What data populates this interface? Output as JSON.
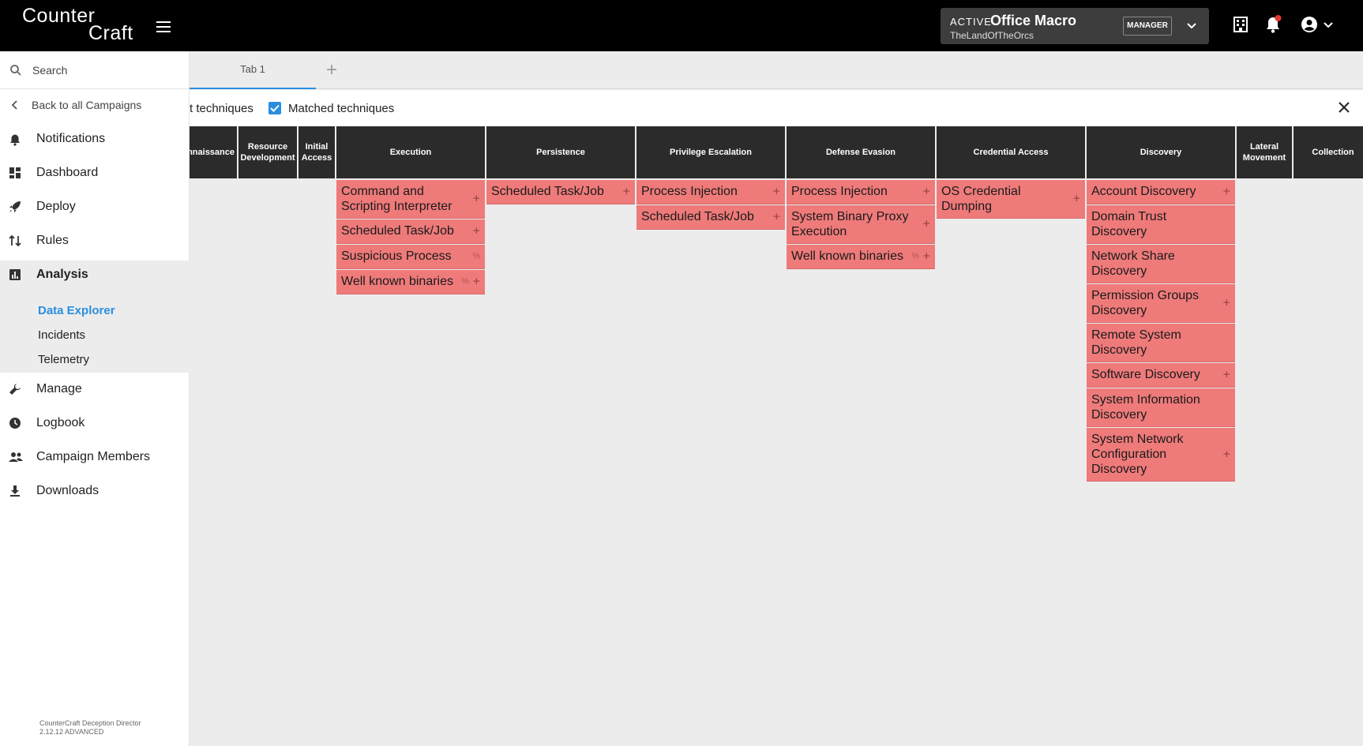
{
  "app": {
    "logo_line1": "Counter",
    "logo_line2": "Craft"
  },
  "campaign": {
    "status": "ACTIVE",
    "name": "Office Macro",
    "org": "TheLandOfTheOrcs",
    "role": "MANAGER"
  },
  "sidebar": {
    "search_placeholder": "Search",
    "back_label": "Back to all Campaigns",
    "items": [
      {
        "label": "Notifications",
        "icon": "bell-icon"
      },
      {
        "label": "Dashboard",
        "icon": "dashboard-icon"
      },
      {
        "label": "Deploy",
        "icon": "rocket-icon"
      },
      {
        "label": "Rules",
        "icon": "rules-icon"
      },
      {
        "label": "Analysis",
        "icon": "analytics-icon"
      },
      {
        "label": "Manage",
        "icon": "wrench-icon"
      },
      {
        "label": "Logbook",
        "icon": "clock-icon"
      },
      {
        "label": "Campaign Members",
        "icon": "people-icon"
      },
      {
        "label": "Downloads",
        "icon": "download-icon"
      }
    ],
    "analysis_sub": [
      "Data Explorer",
      "Incidents",
      "Telemetry"
    ],
    "version_line1": "CounterCraft Deception Director",
    "version_line2": "2.12.12 ADVANCED"
  },
  "tabs": {
    "tab1": "Tab 1",
    "add": "+"
  },
  "filter": {
    "cut_label": "t techniques",
    "matched_label": "Matched techniques",
    "matched_checked": true
  },
  "matrix": {
    "columns": [
      {
        "title": "nnaissance",
        "techniques": []
      },
      {
        "title": "Resource Development",
        "techniques": []
      },
      {
        "title": "Initial Access",
        "techniques": []
      },
      {
        "title": "Execution",
        "techniques": [
          {
            "name": "Command and Scripting Interpreter",
            "mark": "+"
          },
          {
            "name": "Scheduled Task/Job",
            "mark": "+"
          },
          {
            "name": "Suspicious Process",
            "mark": "%"
          },
          {
            "name": "Well known binaries",
            "mark": "%+"
          }
        ]
      },
      {
        "title": "Persistence",
        "techniques": [
          {
            "name": "Scheduled Task/Job",
            "mark": "+"
          }
        ]
      },
      {
        "title": "Privilege Escalation",
        "techniques": [
          {
            "name": "Process Injection",
            "mark": "+"
          },
          {
            "name": "Scheduled Task/Job",
            "mark": "+"
          }
        ]
      },
      {
        "title": "Defense Evasion",
        "techniques": [
          {
            "name": "Process Injection",
            "mark": "+"
          },
          {
            "name": "System Binary Proxy Execution",
            "mark": "+"
          },
          {
            "name": "Well known binaries",
            "mark": "%+"
          }
        ]
      },
      {
        "title": "Credential Access",
        "techniques": [
          {
            "name": "OS Credential Dumping",
            "mark": "+"
          }
        ]
      },
      {
        "title": "Discovery",
        "techniques": [
          {
            "name": "Account Discovery",
            "mark": "+"
          },
          {
            "name": "Domain Trust Discovery",
            "mark": ""
          },
          {
            "name": "Network Share Discovery",
            "mark": ""
          },
          {
            "name": "Permission Groups Discovery",
            "mark": "+"
          },
          {
            "name": "Remote System Discovery",
            "mark": ""
          },
          {
            "name": "Software Discovery",
            "mark": "+"
          },
          {
            "name": "System Information Discovery",
            "mark": ""
          },
          {
            "name": "System Network Configuration Discovery",
            "mark": "+"
          }
        ]
      },
      {
        "title": "Lateral Movement",
        "techniques": []
      },
      {
        "title": "Collection",
        "techniques": []
      }
    ]
  },
  "colors": {
    "accent": "#2a8ee0",
    "technique_bg": "#ef7a7a",
    "header_bg": "#2b2b2b",
    "topbar_bg": "#000000"
  }
}
